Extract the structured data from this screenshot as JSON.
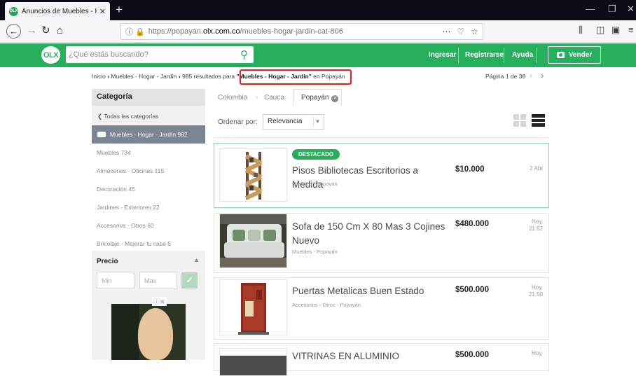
{
  "browser": {
    "tab_title": "Anuncios de Muebles - Hogar",
    "tab_favicon": "OLX",
    "tab_close": "✕",
    "new_tab": "+",
    "url_prefix": "https://popayan.",
    "url_domain": "olx.com.co",
    "url_path": "/muebles-hogar-jardin-cat-806",
    "page_actions": "⋯",
    "window_minimize": "—",
    "window_restore": "❐",
    "window_close": "✕",
    "back": "←",
    "forward": "→",
    "reload": "↻",
    "home": "⌂"
  },
  "header": {
    "logo": "OLX",
    "search_placeholder": "¿Qué estás buscando?",
    "login": "Ingresar",
    "register": "Registrarse",
    "help": "Ayuda",
    "sell": "Vender"
  },
  "breadcrumb": {
    "home": "Inicio",
    "category": "Muebles - Hogar - Jardín",
    "results_prefix": "985 resultados para",
    "query": "\"Muebles - Hogar - Jardín\"",
    "location_suffix": "en Popayán",
    "page_info": "Página 1 de 38"
  },
  "sidebar": {
    "category_title": "Categoría",
    "all_categories": "Todas las categorías",
    "current_category": "Muebles - Hogar - Jardín 982",
    "subcategories": [
      "Muebles 734",
      "Almacenes - Oficinas 115",
      "Decoración 45",
      "Jardines - Exteriores 22",
      "Accesorios - Otros 60",
      "Bricolaje - Mejorar tu casa 6"
    ],
    "price_title": "Precio",
    "min_placeholder": "Min",
    "max_placeholder": "Max"
  },
  "filters": {
    "locations": [
      "Colombia",
      "Cauca",
      "Popayán"
    ],
    "sort_label": "Ordenar por:",
    "sort_value": "Relevancia"
  },
  "listings": [
    {
      "badge": "DESTACADO",
      "title": "Pisos Bibliotecas Escritorios a Medida",
      "location": "Muebles - Popayán",
      "price": "$10.000",
      "date": "2 Abr"
    },
    {
      "title": "Sofa de 150 Cm X 80 Mas 3 Cojines Nuevo",
      "location": "Muebles - Popayán",
      "price": "$480.000",
      "date_line1": "Hoy,",
      "date_line2": "21:52"
    },
    {
      "title": "Puertas Metalicas Buen Estado",
      "location": "Accesorios - Otros - Popayán",
      "price": "$500.000",
      "date_line1": "Hoy,",
      "date_line2": "21:50"
    },
    {
      "title": "VITRINAS EN ALUMINIO",
      "price": "$500.000",
      "date_line1": "Hoy,"
    }
  ]
}
